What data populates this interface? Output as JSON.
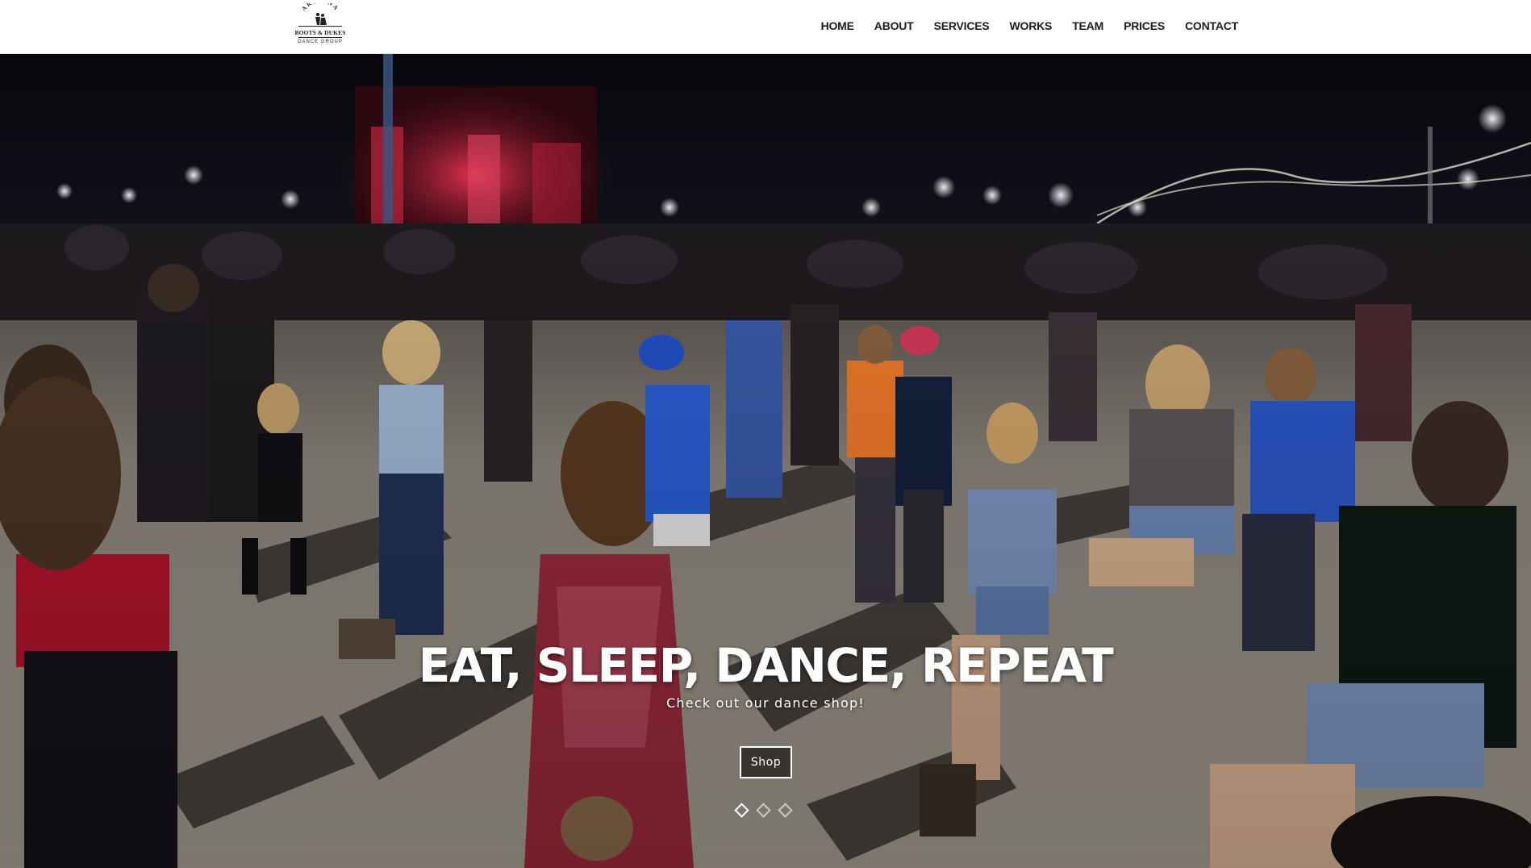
{
  "logo": {
    "top_text": "ARIZONA",
    "main_text": "BOOTS & DUKES",
    "sub_text": "DANCE GROUP"
  },
  "nav": {
    "items": [
      {
        "label": "HOME"
      },
      {
        "label": "ABOUT"
      },
      {
        "label": "SERVICES"
      },
      {
        "label": "WORKS"
      },
      {
        "label": "TEAM"
      },
      {
        "label": "PRICES"
      },
      {
        "label": "CONTACT"
      }
    ]
  },
  "hero": {
    "title": "EAT, SLEEP, DANCE, REPEAT",
    "subtitle": "Check out our dance shop!",
    "button_label": "Shop",
    "slides_count": 3,
    "active_slide": 1
  },
  "colors": {
    "header_bg": "#ffffff",
    "nav_text": "#1c1c1c",
    "hero_text": "#ffffff",
    "night_sky": "#0b0b12"
  }
}
